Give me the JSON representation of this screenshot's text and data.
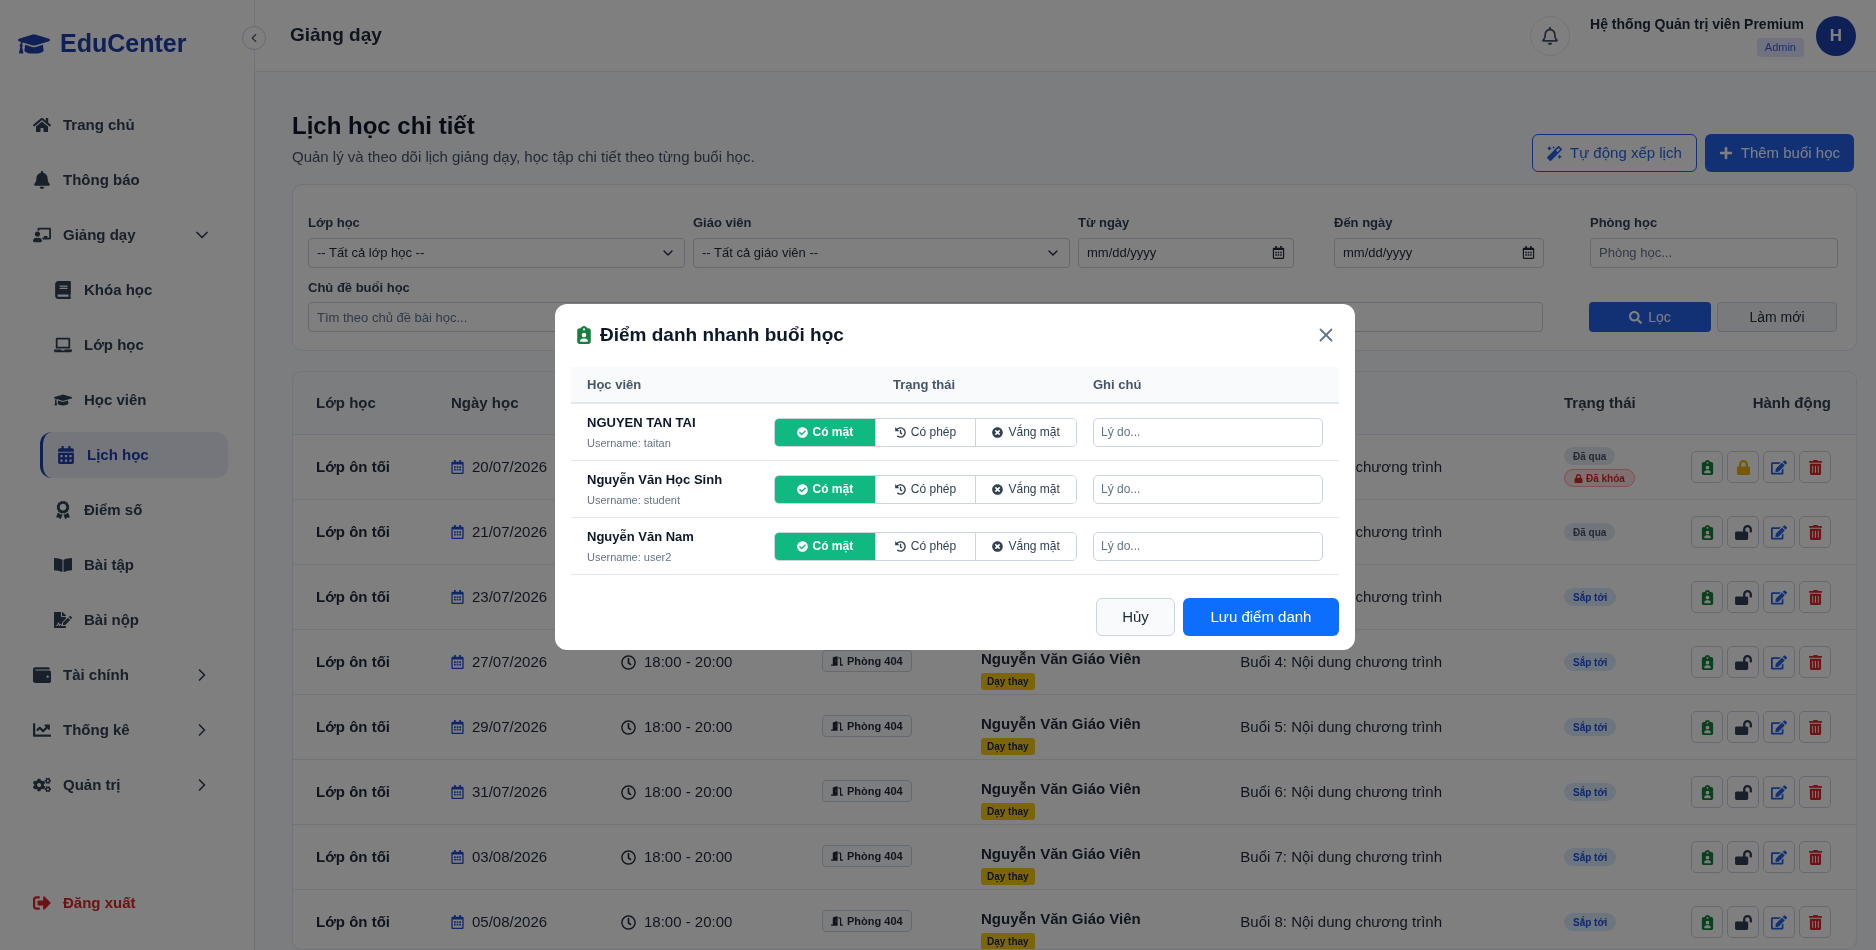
{
  "sidebar": {
    "logo": "EduCenter",
    "items": [
      {
        "label": "Trang chủ",
        "selected": false
      },
      {
        "label": "Thông báo",
        "selected": false
      },
      {
        "label": "Giảng dạy",
        "selected": false,
        "expanded": true,
        "children": [
          {
            "label": "Khóa học",
            "selected": false
          },
          {
            "label": "Lớp học",
            "selected": false
          },
          {
            "label": "Học viên",
            "selected": false
          },
          {
            "label": "Lịch học",
            "selected": true
          },
          {
            "label": "Điểm số",
            "selected": false
          },
          {
            "label": "Bài tập",
            "selected": false
          },
          {
            "label": "Bài nộp",
            "selected": false
          }
        ]
      },
      {
        "label": "Tài chính",
        "selected": false,
        "expanded": false
      },
      {
        "label": "Thống kê",
        "selected": false,
        "expanded": false
      },
      {
        "label": "Quản trị",
        "selected": false,
        "expanded": false
      }
    ],
    "logout": "Đăng xuất"
  },
  "header": {
    "title": "Giảng dạy",
    "user": "Hệ thống Quản trị viên Premium",
    "role": "Admin",
    "avatar": "H"
  },
  "page": {
    "title": "Lịch học chi tiết",
    "subtitle": "Quản lý và theo dõi lịch giảng dạy, học tập chi tiết theo từng buổi học.",
    "buttons": [
      {
        "label": "Tự động xếp lịch",
        "kind": "outline"
      },
      {
        "label": "Thêm buổi học",
        "kind": "primary"
      }
    ]
  },
  "filters": {
    "fields": [
      {
        "label": "Lớp học",
        "kind": "select",
        "value": "-- Tất cả lớp học --"
      },
      {
        "label": "Giáo viên",
        "kind": "select",
        "value": "-- Tất cả giáo viên --"
      },
      {
        "label": "Từ ngày",
        "kind": "date",
        "placeholder": "mm/dd/yyyy"
      },
      {
        "label": "Đến ngày",
        "kind": "date",
        "placeholder": "mm/dd/yyyy"
      },
      {
        "label": "Phòng học",
        "kind": "text",
        "placeholder": "Phòng học..."
      }
    ],
    "topic": {
      "label": "Chủ đề buổi học",
      "placeholder": "Tìm theo chủ đề bài học..."
    },
    "buttons": [
      {
        "label": "Lọc",
        "kind": "primary"
      },
      {
        "label": "Làm mới",
        "kind": "light"
      }
    ]
  },
  "table": {
    "headers": {
      "class": "Lớp học",
      "date": "Ngày học",
      "status": "Trạng thái",
      "actions": "Hành động"
    },
    "rows": [
      {
        "class": "Lớp ôn tối",
        "date": "20/07/2026",
        "topic": "chương trình",
        "statuses": [
          {
            "label": "Đã qua",
            "kind": "past"
          },
          {
            "label": "Đã khóa",
            "kind": "locked"
          }
        ],
        "locked": true
      },
      {
        "class": "Lớp ôn tối",
        "date": "21/07/2026",
        "topic": "chương trình",
        "statuses": [
          {
            "label": "Đã qua",
            "kind": "past"
          }
        ],
        "locked": false
      },
      {
        "class": "Lớp ôn tối",
        "date": "23/07/2026",
        "topic": "chương trình",
        "statuses": [
          {
            "label": "Sắp tới",
            "kind": "upcoming"
          }
        ],
        "locked": false
      },
      {
        "class": "Lớp ôn tối",
        "date": "27/07/2026",
        "time": "18:00 - 20:00",
        "room": "Phòng 404",
        "teacher": "Nguyễn Văn Giáo Viên",
        "substitute": "Dạy thay",
        "topic": "Buổi 4: Nội dung chương trình",
        "statuses": [
          {
            "label": "Sắp tới",
            "kind": "upcoming"
          }
        ],
        "locked": false
      },
      {
        "class": "Lớp ôn tối",
        "date": "29/07/2026",
        "time": "18:00 - 20:00",
        "room": "Phòng 404",
        "teacher": "Nguyễn Văn Giáo Viên",
        "substitute": "Dạy thay",
        "topic": "Buổi 5: Nội dung chương trình",
        "statuses": [
          {
            "label": "Sắp tới",
            "kind": "upcoming"
          }
        ],
        "locked": false
      },
      {
        "class": "Lớp ôn tối",
        "date": "31/07/2026",
        "time": "18:00 - 20:00",
        "room": "Phòng 404",
        "teacher": "Nguyễn Văn Giáo Viên",
        "substitute": "Dạy thay",
        "topic": "Buổi 6: Nội dung chương trình",
        "statuses": [
          {
            "label": "Sắp tới",
            "kind": "upcoming"
          }
        ],
        "locked": false
      },
      {
        "class": "Lớp ôn tối",
        "date": "03/08/2026",
        "time": "18:00 - 20:00",
        "room": "Phòng 404",
        "teacher": "Nguyễn Văn Giáo Viên",
        "substitute": "Dạy thay",
        "topic": "Buổi 7: Nội dung chương trình",
        "statuses": [
          {
            "label": "Sắp tới",
            "kind": "upcoming"
          }
        ],
        "locked": false
      },
      {
        "class": "Lớp ôn tối",
        "date": "05/08/2026",
        "time": "18:00 - 20:00",
        "room": "Phòng 404",
        "teacher": "Nguyễn Văn Giáo Viên",
        "substitute": "Dạy thay",
        "topic": "Buổi 8: Nội dung chương trình",
        "statuses": [
          {
            "label": "Sắp tới",
            "kind": "upcoming"
          }
        ],
        "locked": false
      }
    ]
  },
  "modal": {
    "title": "Điểm danh nhanh buổi học",
    "columns": [
      "Học viên",
      "Trạng thái",
      "Ghi chú"
    ],
    "students": [
      {
        "name": "NGUYEN TAN TAI",
        "username": "Username: taitan",
        "note_placeholder": "Lý do...",
        "options": [
          {
            "label": "Có mặt",
            "kind": "present",
            "selected": true
          },
          {
            "label": "Có phép",
            "kind": "excused",
            "selected": false
          },
          {
            "label": "Vắng mặt",
            "kind": "absent",
            "selected": false
          }
        ]
      },
      {
        "name": "Nguyễn Văn Học Sinh",
        "username": "Username: student",
        "note_placeholder": "Lý do...",
        "options": [
          {
            "label": "Có mặt",
            "kind": "present",
            "selected": true
          },
          {
            "label": "Có phép",
            "kind": "excused",
            "selected": false
          },
          {
            "label": "Vắng mặt",
            "kind": "absent",
            "selected": false
          }
        ]
      },
      {
        "name": "Nguyễn Văn Nam",
        "username": "Username: user2",
        "note_placeholder": "Lý do...",
        "options": [
          {
            "label": "Có mặt",
            "kind": "present",
            "selected": true
          },
          {
            "label": "Có phép",
            "kind": "excused",
            "selected": false
          },
          {
            "label": "Vắng mặt",
            "kind": "absent",
            "selected": false
          }
        ]
      }
    ],
    "buttons": [
      {
        "label": "Hủy",
        "kind": "secondary"
      },
      {
        "label": "Lưu điểm danh",
        "kind": "primary"
      }
    ]
  }
}
